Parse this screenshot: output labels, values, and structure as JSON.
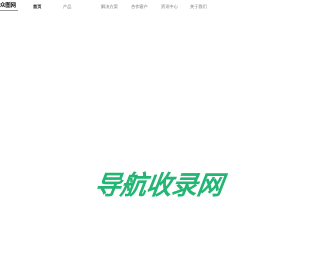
{
  "logo": {
    "text": "众图网"
  },
  "nav": {
    "items": [
      {
        "label": "首页",
        "active": true
      },
      {
        "label": "产品",
        "active": false
      },
      {
        "label": "解决方案",
        "active": false
      },
      {
        "label": "合作客户",
        "active": false
      },
      {
        "label": "资讯中心",
        "active": false
      },
      {
        "label": "关于我们",
        "active": false
      }
    ]
  },
  "hero": {
    "watermark_text": "导航收录网",
    "color": "#22b573"
  }
}
